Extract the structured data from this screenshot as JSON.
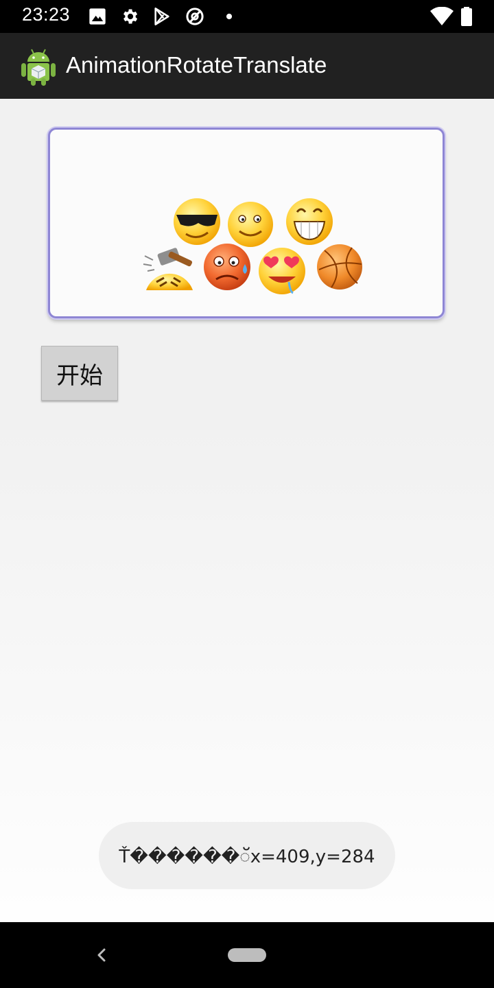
{
  "status_bar": {
    "time": "23:23",
    "icons": [
      "image-icon",
      "settings-gear-icon",
      "play-store-icon",
      "at-sign-icon",
      "dot-icon"
    ],
    "right_icons": [
      "wifi-icon",
      "battery-icon"
    ]
  },
  "app_bar": {
    "title": "AnimationRotateTranslate",
    "icon": "android-app-icon"
  },
  "animation_frame": {
    "emojis": [
      "cool-sunglasses-emoji",
      "smile-emoji",
      "grin-emoji",
      "hammer-emoji",
      "worried-sweat-emoji",
      "heart-eyes-emoji",
      "basketball-icon"
    ]
  },
  "start_button": {
    "label": "开始"
  },
  "toast": {
    "text": "Ť������ॅx=409,y=284"
  },
  "nav_bar": {
    "back": "back-icon",
    "home": "home-pill"
  },
  "colors": {
    "status_bar": "#000000",
    "app_bar": "#212121",
    "frame_border": "#8e86d4",
    "button_bg": "#d2d2d2",
    "toast_bg": "#efefef"
  }
}
